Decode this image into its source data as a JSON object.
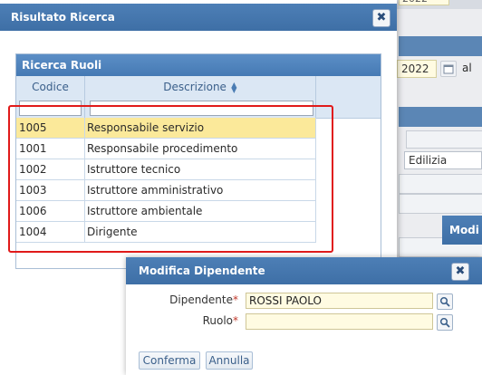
{
  "background": {
    "year_top": "2022",
    "year_field": "2022",
    "al_label": "al",
    "edilizia_value": "Edilizia",
    "ho_label": "Mo"
  },
  "main_dialog": {
    "title": "Risultato Ricerca",
    "close_glyph": "✖",
    "grid": {
      "title": "Ricerca Ruoli",
      "columns": [
        "Codice",
        "Descrizione"
      ],
      "sort_glyph": "▲▼",
      "rows": [
        {
          "codice": "1005",
          "descrizione": "Responsabile servizio",
          "selected": true
        },
        {
          "codice": "1001",
          "descrizione": "Responsabile procedimento",
          "selected": false
        },
        {
          "codice": "1002",
          "descrizione": "Istruttore tecnico",
          "selected": false
        },
        {
          "codice": "1003",
          "descrizione": "Istruttore amministrativo",
          "selected": false
        },
        {
          "codice": "1006",
          "descrizione": "Istruttore ambientale",
          "selected": false
        },
        {
          "codice": "1004",
          "descrizione": "Dirigente",
          "selected": false
        }
      ]
    }
  },
  "dipendente_dialog": {
    "title": "Modifica Dipendente",
    "close_glyph": "✖",
    "dipendente_label": "Dipendente",
    "dipendente_value": "ROSSI PAOLO",
    "ruolo_label": "Ruolo",
    "ruolo_value": "",
    "required_mark": "*",
    "confirm_label": "Conferma",
    "cancel_label": "Annulla"
  },
  "back_dialog": {
    "title": "Modi"
  },
  "colors": {
    "titlebar": "#4a7cb3",
    "selected_row": "#fbe99a",
    "highlight": "#e01a1a",
    "input_bg": "#fffbe2"
  }
}
